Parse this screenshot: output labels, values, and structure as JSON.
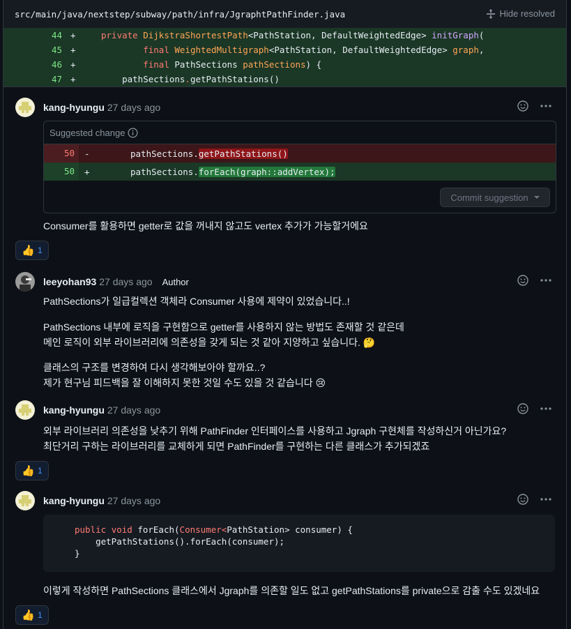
{
  "file": {
    "path": "src/main/java/nextstep/subway/path/infra/JgraphtPathFinder.java",
    "hide_resolved": "Hide resolved"
  },
  "diff_lines": [
    {
      "num": "44",
      "sign": "+",
      "code": "private DijkstraShortestPath<PathStation, DefaultWeightedEdge> initGraph("
    },
    {
      "num": "45",
      "sign": "+",
      "code": "        final WeightedMultigraph<PathStation, DefaultWeightedEdge> graph,"
    },
    {
      "num": "46",
      "sign": "+",
      "code": "        final PathSections pathSections) {"
    },
    {
      "num": "47",
      "sign": "+",
      "code": "    pathSections.getPathStations()"
    }
  ],
  "comments": [
    {
      "author": "kang-hyungu",
      "time": "27 days ago",
      "suggestion": {
        "label": "Suggested change",
        "del_num": "50",
        "del_sign": "-",
        "del_prefix": "pathSections.",
        "del_hl": "getPathStations()",
        "add_num": "50",
        "add_sign": "+",
        "add_prefix": "pathSections.",
        "add_hl": "forEach(graph::addVertex);",
        "commit_label": "Commit suggestion"
      },
      "body": "Consumer를 활용하면 getter로 값을 꺼내지 않고도 vertex 추가가 가능할거에요",
      "reaction": {
        "emoji": "👍",
        "count": "1"
      }
    },
    {
      "author": "leeyohan93",
      "time": "27 days ago",
      "badge": "Author",
      "p1": "PathSections가 일급컬렉션 객체라 Consumer 사용에 제약이 있었습니다..!",
      "p2a": "PathSections 내부에 로직을 구현함으로 getter를 사용하지 않는 방법도 존재할 것 같은데",
      "p2b": "메인 로직이 외부 라이브러리에 의존성을 갖게 되는 것 같아 지양하고 싶습니다. 🤔",
      "p3a": "클래스의 구조를 변경하여 다시 생각해보아야 할까요..?",
      "p3b": "제가 현구님 피드백을 잘 이해하지 못한 것일 수도 있을 것 같습니다 😢"
    },
    {
      "author": "kang-hyungu",
      "time": "27 days ago",
      "l1": "외부 라이브러리 의존성을 낮추기 위해 PathFinder 인터페이스를 사용하고 Jgraph 구현체를 작성하신거 아닌가요?",
      "l2": "최단거리 구하는 라이브러리를 교체하게 되면 PathFinder를 구현하는 다른 클래스가 추가되겠죠",
      "reaction": {
        "emoji": "👍",
        "count": "1"
      }
    },
    {
      "author": "kang-hyungu",
      "time": "27 days ago",
      "code": {
        "l1_kw1": "public",
        "l1_kw2": "void",
        "l1_fn": "forEach(",
        "l1_ty": "Consumer<",
        "l1_rest": "PathStation> consumer) {",
        "l2": "    getPathStations().forEach(consumer);",
        "l3": "}"
      },
      "body": "이렇게 작성하면 PathSections 클래스에서 Jgraph를 의존할 일도 없고 getPathStations를 private으로 감출 수도 있겠네요",
      "reaction": {
        "emoji": "👍",
        "count": "1"
      }
    }
  ]
}
